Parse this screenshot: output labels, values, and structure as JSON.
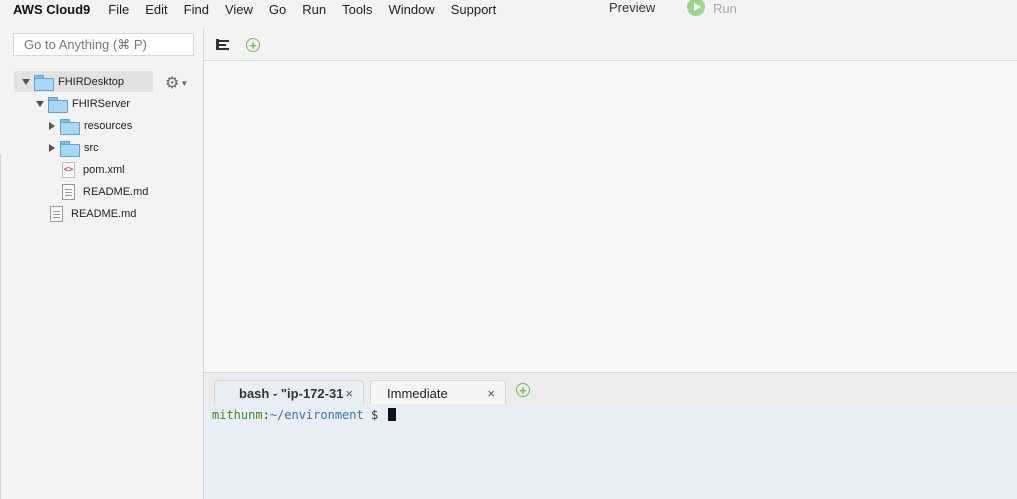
{
  "menubar": {
    "brand": "AWS Cloud9",
    "items": [
      "File",
      "Edit",
      "Find",
      "View",
      "Go",
      "Run",
      "Tools",
      "Window",
      "Support"
    ],
    "preview": "Preview",
    "run": "Run"
  },
  "sidebar": {
    "search_placeholder": "Go to Anything (⌘ P)",
    "tree": [
      {
        "label": "FHIRDesktop",
        "type": "folder",
        "expanded": true,
        "selected": true
      },
      {
        "label": "FHIRServer",
        "type": "folder",
        "expanded": true
      },
      {
        "label": "resources",
        "type": "folder",
        "expanded": false
      },
      {
        "label": "src",
        "type": "folder",
        "expanded": false
      },
      {
        "label": "pom.xml",
        "type": "xml-file"
      },
      {
        "label": "README.md",
        "type": "file"
      },
      {
        "label": "README.md",
        "type": "file"
      }
    ]
  },
  "terminal": {
    "tabs": [
      {
        "label": "bash - \"ip-172-31",
        "active": true
      },
      {
        "label": "Immediate",
        "active": false
      }
    ],
    "close_glyph": "×",
    "user": "mithunm",
    "sep": ":",
    "path": "~/environment",
    "prompt": " $ "
  },
  "colors": {
    "run_green": "#9fd48a",
    "add_green": "#6fbf4f",
    "folder_blue": "#a8d8f5",
    "terminal_bg": "#e8eef6"
  }
}
